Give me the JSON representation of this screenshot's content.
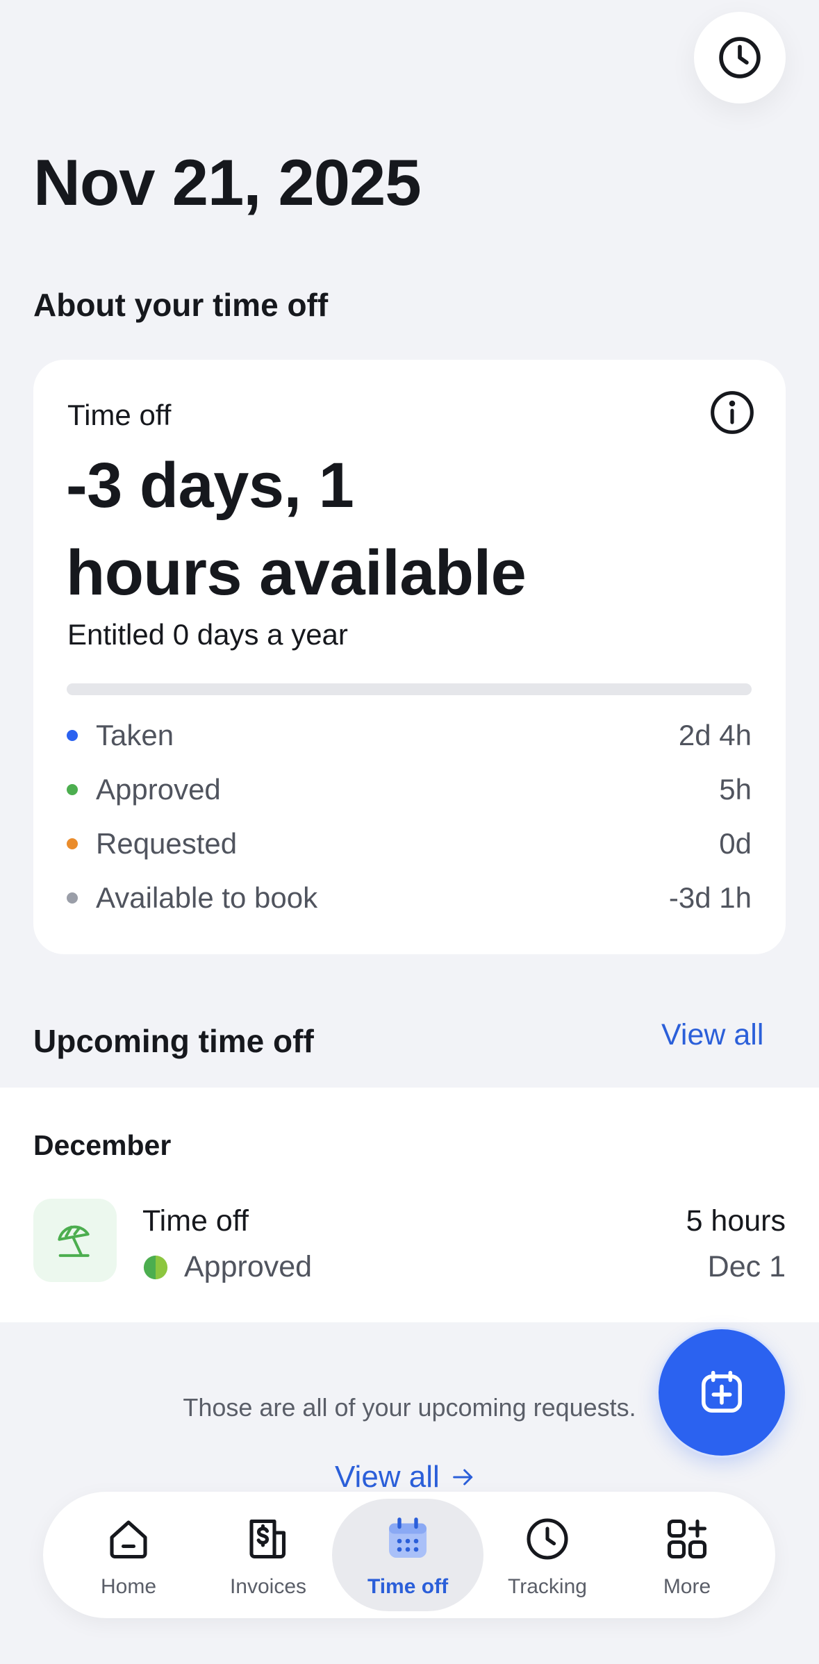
{
  "header": {
    "date": "Nov 21, 2025"
  },
  "time_off_summary": {
    "section_title": "About your time off",
    "card_label": "Time off",
    "balance_line1": "-3 days, 1",
    "balance_line2": "hours available",
    "entitlement": "Entitled 0 days a year",
    "legend": [
      {
        "label": "Taken",
        "value": "2d 4h",
        "color": "#2b62f0"
      },
      {
        "label": "Approved",
        "value": "5h",
        "color": "#4cae4f"
      },
      {
        "label": "Requested",
        "value": "0d",
        "color": "#ea8c2c"
      },
      {
        "label": "Available to book",
        "value": "-3d 1h",
        "color": "#9a9ea8"
      }
    ]
  },
  "upcoming": {
    "section_title": "Upcoming time off",
    "view_all_label": "View all",
    "month": "December",
    "items": [
      {
        "type": "Time off",
        "status": "Approved",
        "duration": "5 hours",
        "date": "Dec 1"
      }
    ],
    "end_note": "Those are all of your upcoming requests.",
    "view_all_bottom_label": "View all"
  },
  "tabbar": {
    "tabs": [
      {
        "label": "Home",
        "icon": "home-icon"
      },
      {
        "label": "Invoices",
        "icon": "invoice-icon"
      },
      {
        "label": "Time off",
        "icon": "calendar-icon",
        "active": true
      },
      {
        "label": "Tracking",
        "icon": "clock-icon"
      },
      {
        "label": "More",
        "icon": "grid-plus-icon"
      }
    ]
  },
  "colors": {
    "accent": "#2b5fd9",
    "fab": "#2b62f0",
    "background": "#f2f3f7"
  }
}
